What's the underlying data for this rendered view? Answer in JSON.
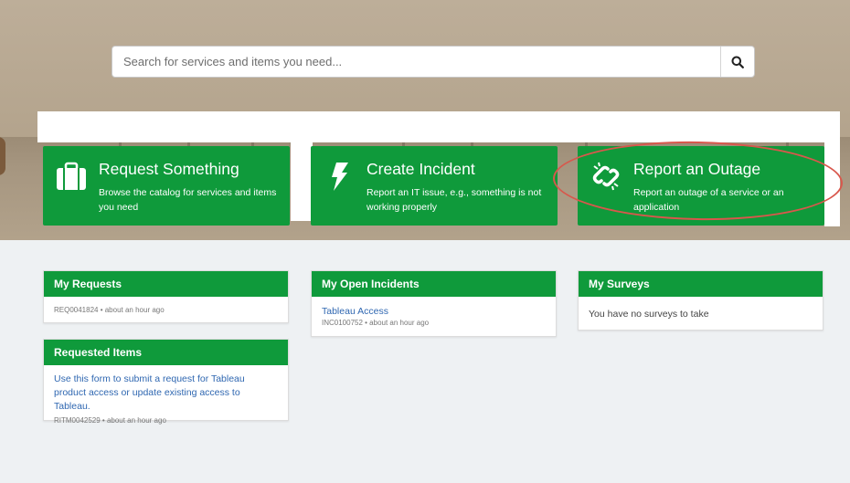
{
  "search": {
    "placeholder": "Search for services and items you need..."
  },
  "tiles": [
    {
      "icon": "briefcase-icon",
      "title": "Request Something",
      "description": "Browse the catalog for services and items you need"
    },
    {
      "icon": "lightning-icon",
      "title": "Create Incident",
      "description": "Report an IT issue, e.g., something is not working properly"
    },
    {
      "icon": "broken-link-icon",
      "title": "Report an Outage",
      "description": "Report an outage of a service or an application"
    }
  ],
  "widgets": {
    "my_requests": {
      "title": "My Requests",
      "items": [
        {
          "meta": "REQ0041824 • about an hour ago"
        }
      ]
    },
    "requested_items": {
      "title": "Requested Items",
      "items": [
        {
          "link": "Use this form to submit a request for Tableau product access or update existing access to Tableau.",
          "meta": "RITM0042529 • about an hour ago"
        }
      ]
    },
    "my_open_incidents": {
      "title": "My Open Incidents",
      "items": [
        {
          "link": "Tableau Access",
          "meta": "INC0100752 • about an hour ago"
        }
      ]
    },
    "my_surveys": {
      "title": "My Surveys",
      "empty_text": "You have no surveys to take"
    }
  },
  "colors": {
    "brand_green": "#0f9a3b",
    "highlight_red": "#d8574c",
    "link_blue": "#2f67b1"
  }
}
